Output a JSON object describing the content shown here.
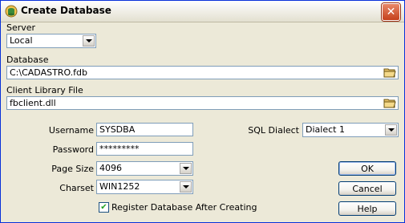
{
  "window": {
    "title": "Create Database",
    "close_symbol": "✕"
  },
  "server": {
    "label": "Server",
    "value": "Local"
  },
  "database": {
    "label": "Database",
    "value": "C:\\CADASTRO.fdb"
  },
  "client_library": {
    "label": "Client Library File",
    "value": "fbclient.dll"
  },
  "username": {
    "label": "Username",
    "value": "SYSDBA"
  },
  "password": {
    "label": "Password",
    "value": "*********"
  },
  "page_size": {
    "label": "Page Size",
    "value": "4096"
  },
  "charset": {
    "label": "Charset",
    "value": "WIN1252"
  },
  "sql_dialect": {
    "label": "SQL Dialect",
    "value": "Dialect 1"
  },
  "register": {
    "label": "Register Database After Creating",
    "checked": true,
    "check_symbol": "✔"
  },
  "buttons": {
    "ok": "OK",
    "cancel": "Cancel",
    "help": "Help"
  },
  "colors": {
    "title_accent": "#0831d9",
    "field_border": "#7f9db9",
    "dialog_bg": "#ece9d8"
  }
}
